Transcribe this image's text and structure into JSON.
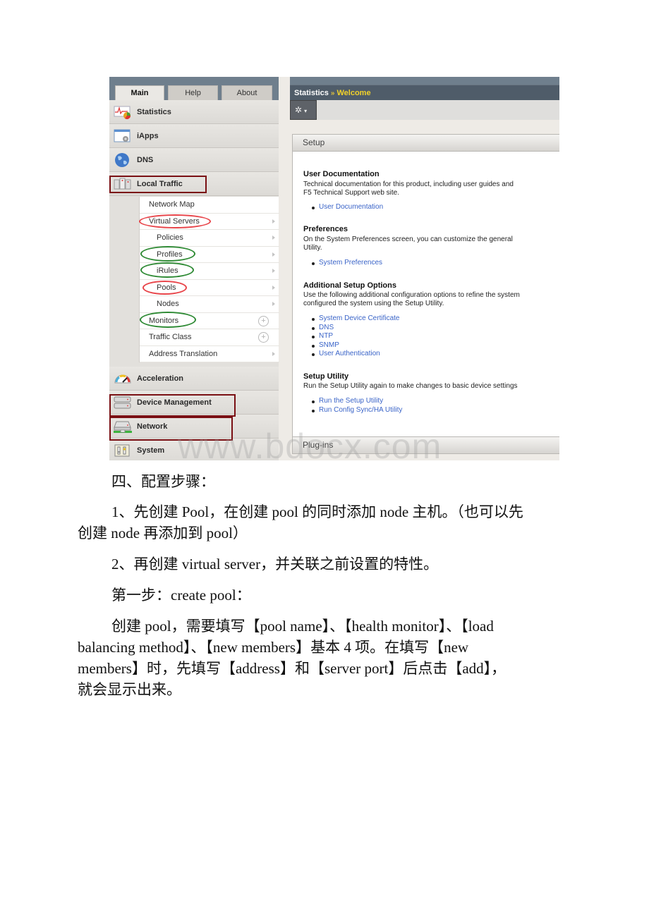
{
  "screenshot": {
    "nav_tabs": [
      {
        "label": "Main",
        "active": true
      },
      {
        "label": "Help",
        "active": false
      },
      {
        "label": "About",
        "active": false
      }
    ],
    "nav_items": [
      {
        "label": "Statistics",
        "icon": "statistics-chart-icon"
      },
      {
        "label": "iApps",
        "icon": "iapps-window-gear-icon"
      },
      {
        "label": "DNS",
        "icon": "globe-icon"
      },
      {
        "label": "Local Traffic",
        "icon": "servers-icon"
      },
      {
        "label": "Acceleration",
        "icon": "speedometer-icon"
      },
      {
        "label": "Device Management",
        "icon": "device-stack-icon"
      },
      {
        "label": "Network",
        "icon": "network-device-icon"
      },
      {
        "label": "System",
        "icon": "system-switch-icon"
      }
    ],
    "local_traffic_submenu": [
      {
        "label": "Network Map",
        "indent": false,
        "control": "none"
      },
      {
        "label": "Virtual Servers",
        "indent": false,
        "control": "arrow"
      },
      {
        "label": "Policies",
        "indent": true,
        "control": "arrow"
      },
      {
        "label": "Profiles",
        "indent": true,
        "control": "arrow"
      },
      {
        "label": "iRules",
        "indent": true,
        "control": "arrow"
      },
      {
        "label": "Pools",
        "indent": true,
        "control": "arrow"
      },
      {
        "label": "Nodes",
        "indent": true,
        "control": "arrow"
      },
      {
        "label": "Monitors",
        "indent": false,
        "control": "plus"
      },
      {
        "label": "Traffic Class",
        "indent": false,
        "control": "plus"
      },
      {
        "label": "Address Translation",
        "indent": false,
        "control": "arrow"
      }
    ],
    "breadcrumb": {
      "parent": "Statistics",
      "separator": "»",
      "current": "Welcome"
    },
    "toolbar": {
      "gear_caret": "▾"
    },
    "panels": {
      "setup": "Setup",
      "plugins": "Plug-ins"
    },
    "sections": [
      {
        "title": "User Documentation",
        "text": [
          "Technical documentation for this product, including user guides and",
          "F5 Technical Support web site."
        ],
        "links": [
          "User Documentation"
        ]
      },
      {
        "title": "Preferences",
        "text": [
          "On the System Preferences screen, you can customize the general",
          "Utility."
        ],
        "links": [
          "System Preferences"
        ]
      },
      {
        "title": "Additional Setup Options",
        "text": [
          "Use the following additional configuration options to refine the system",
          "configured the system using the Setup Utility."
        ],
        "links": [
          "System Device Certificate",
          "DNS",
          "NTP",
          "SNMP",
          "User Authentication"
        ]
      },
      {
        "title": "Setup Utility",
        "text": [
          "Run the Setup Utility again to make changes to basic device settings"
        ],
        "links": [
          "Run the Setup Utility",
          "Run Config Sync/HA Utility"
        ]
      }
    ],
    "annotation_colors": {
      "red_ring": "#e8454a",
      "green_ring": "#2e8a34",
      "dark_box": "#7a1014"
    },
    "watermark": "www.bdocx.com"
  },
  "document": {
    "heading": "四、配置步骤：",
    "step1_line1": "1、先创建 Pool，在创建 pool 的同时添加 node 主机。（也可以先",
    "step1_line2": "创建 node 再添加到 pool）",
    "step2": "2、再创建 virtual server，并关联之前设置的特性。",
    "first_step": "第一步：create pool：",
    "para_line1": "创建 pool，需要填写【pool name】、【health monitor】、【load",
    "para_line2": "balancing method】、【new members】基本 4 项。在填写【new",
    "para_line3": "members】时，先填写【address】和【server port】后点击【add】，",
    "para_line4": "就会显示出来。"
  }
}
